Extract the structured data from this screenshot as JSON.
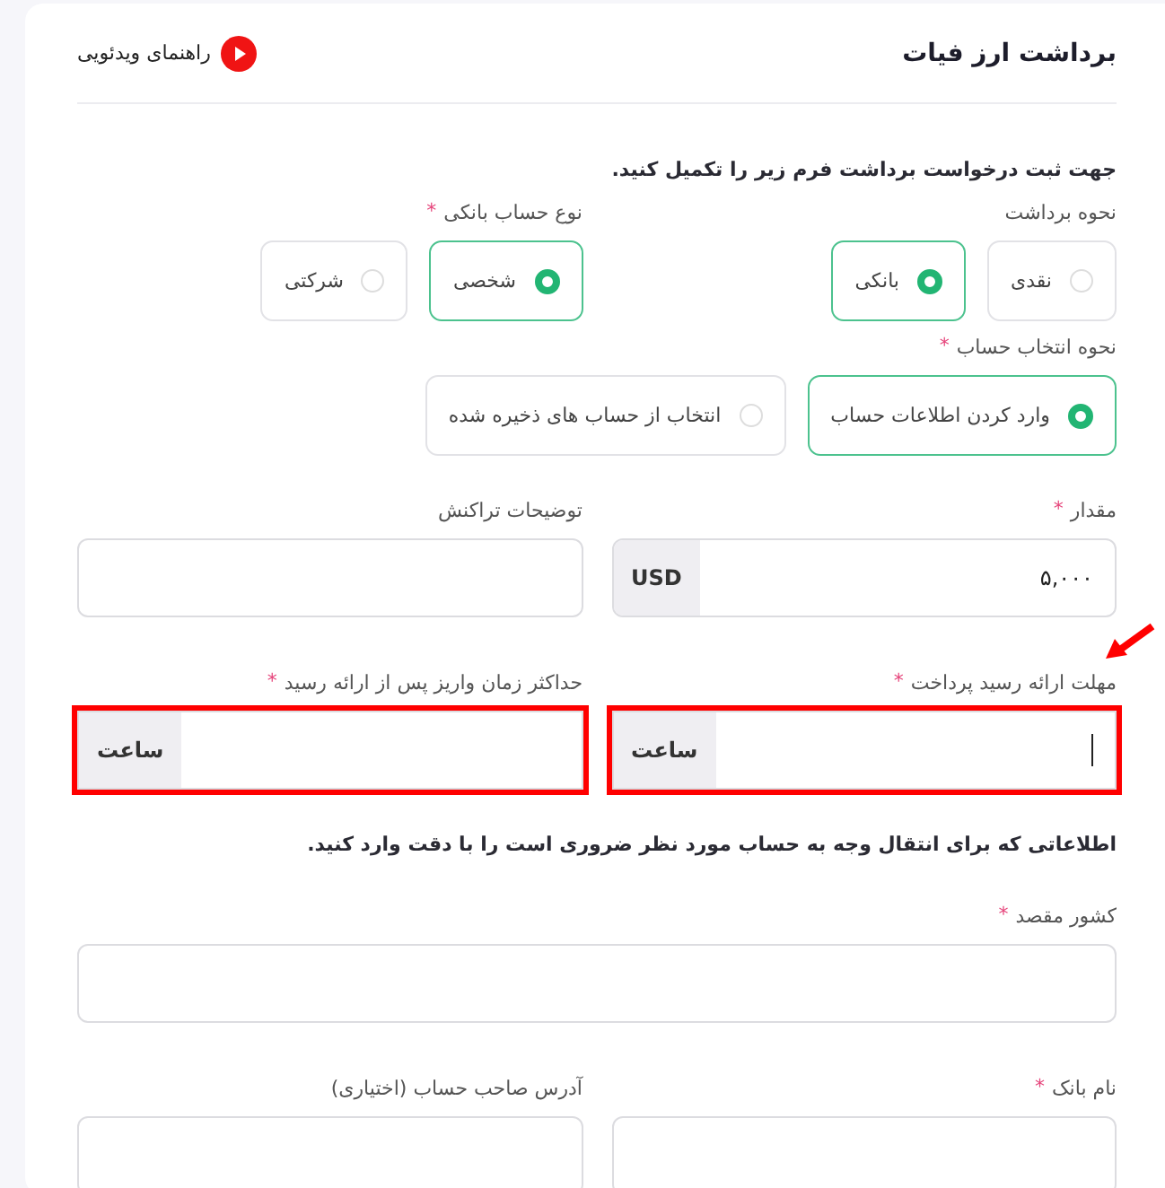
{
  "header": {
    "title": "برداشت ارز فیات",
    "video_link": "راهنمای ویدئویی"
  },
  "intro": "جهت ثبت درخواست برداشت فرم زیر را تکمیل کنید.",
  "rows": [
    {
      "kind": "radio_groups",
      "groups": [
        {
          "label": "نحوه برداشت",
          "options": [
            {
              "label": "نقدی",
              "selected": false
            },
            {
              "label": "بانکی",
              "selected": true
            }
          ]
        },
        {
          "label": "نوع حساب بانکی",
          "required_mark": "*",
          "options": [
            {
              "label": "شخصی",
              "selected": true
            },
            {
              "label": "شرکتی",
              "selected": false
            }
          ]
        }
      ]
    },
    {
      "kind": "radio_groups",
      "groups": [
        {
          "label": "نحوه انتخاب حساب",
          "required_mark": "*",
          "options": [
            {
              "label": "وارد کردن اطلاعات حساب",
              "selected": true
            },
            {
              "label": "انتخاب از حساب های ذخیره شده",
              "selected": false
            }
          ]
        }
      ]
    },
    {
      "kind": "fields",
      "fields": [
        {
          "label": "مقدار",
          "required_mark": "*",
          "value": "۵,۰۰۰",
          "addon": "USD"
        },
        {
          "label": "توضیحات تراکنش"
        }
      ]
    },
    {
      "kind": "fields",
      "pointer": true,
      "fields": [
        {
          "label": "مهلت ارائه رسید پرداخت",
          "required_mark": "*",
          "addon": "ساعت",
          "highlighted": true,
          "focused": true
        },
        {
          "label": "حداکثر زمان واریز پس از ارائه رسید",
          "required_mark": "*",
          "addon": "ساعت",
          "highlighted": true
        }
      ]
    },
    {
      "kind": "note",
      "text": "اطلاعاتی که برای انتقال وجه به حساب مورد نظر ضروری است را با دقت وارد کنید."
    },
    {
      "kind": "fields",
      "fields": [
        {
          "label": "کشور مقصد",
          "required_mark": "*",
          "wide": true
        }
      ]
    },
    {
      "kind": "fields",
      "fields": [
        {
          "label": "نام بانک",
          "required_mark": "*"
        },
        {
          "label": "آدرس صاحب حساب (اختیاری)"
        }
      ]
    }
  ]
}
